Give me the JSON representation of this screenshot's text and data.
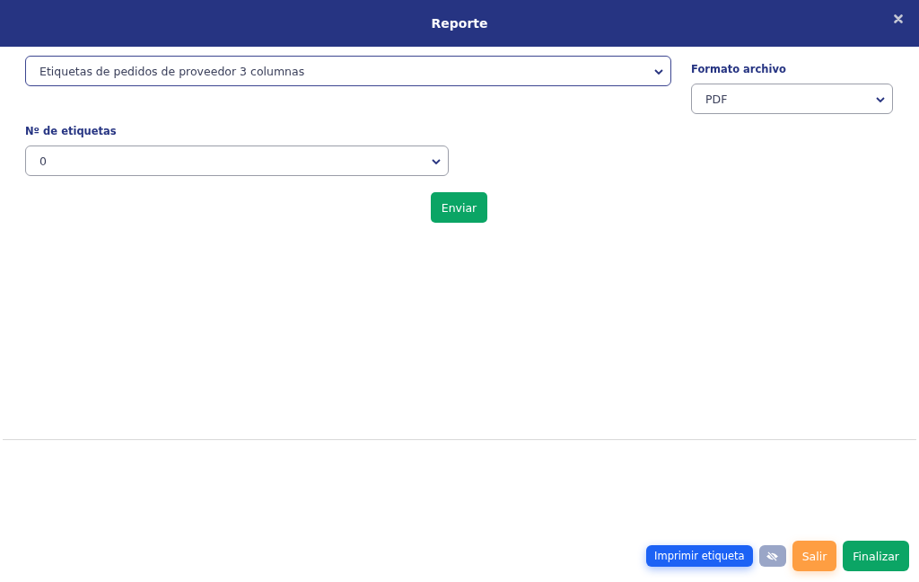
{
  "header": {
    "title": "Reporte"
  },
  "report_select": {
    "value": "Etiquetas de pedidos de proveedor 3 columnas"
  },
  "format": {
    "label": "Formato archivo",
    "value": "PDF"
  },
  "label_count": {
    "label": "Nº de etiquetas",
    "value": "0"
  },
  "submit_button": "Enviar",
  "footer_buttons": [
    {
      "kind": "primary",
      "label": "Imprimir etiqueta"
    },
    {
      "kind": "icon"
    },
    {
      "kind": "warning",
      "label": "Salir"
    },
    {
      "kind": "success",
      "label": "Finalizar"
    }
  ]
}
